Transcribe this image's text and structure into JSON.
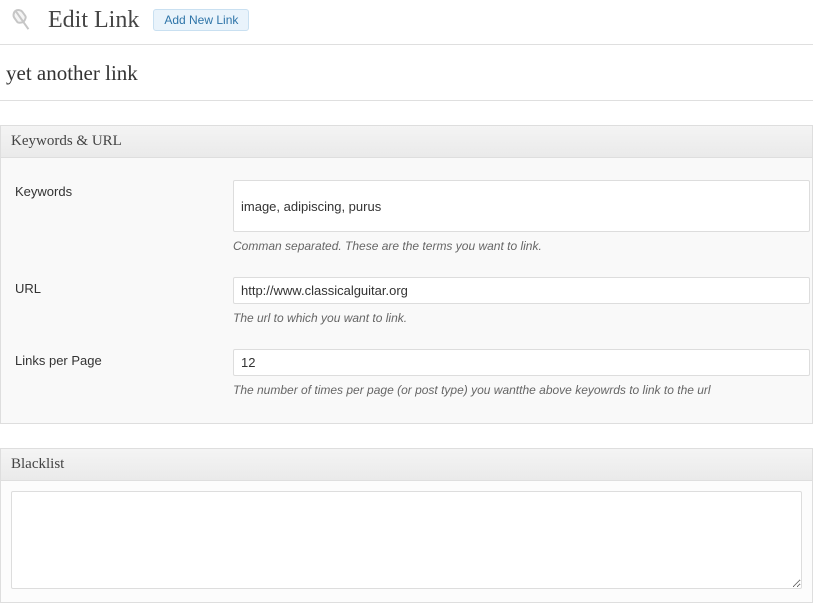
{
  "header": {
    "title": "Edit Link",
    "add_new_label": "Add New Link"
  },
  "link_title": "yet another link",
  "sections": {
    "keywords_url": {
      "title": "Keywords & URL",
      "fields": {
        "keywords": {
          "label": "Keywords",
          "value": "image, adipiscing, purus",
          "help": "Comman separated. These are the terms you want to link."
        },
        "url": {
          "label": "URL",
          "value": "http://www.classicalguitar.org",
          "help": "The url to which you want to link."
        },
        "links_per_page": {
          "label": "Links per Page",
          "value": "12",
          "help": "The number of times per page (or post type) you wantthe above keyowrds to link to the url"
        }
      }
    },
    "blacklist": {
      "title": "Blacklist",
      "value": ""
    }
  }
}
